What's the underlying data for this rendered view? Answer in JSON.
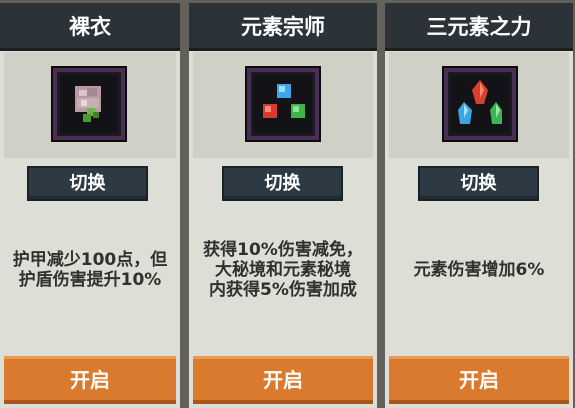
{
  "cards": [
    {
      "title": "裸衣",
      "icon": "naked-robe-icon",
      "switch_label": "切换",
      "description": "护甲减少100点，但\n护盾伤害提升10%",
      "open_label": "开启"
    },
    {
      "title": "元素宗师",
      "icon": "element-master-icon",
      "switch_label": "切换",
      "description": "获得10%伤害减免，\n大秘境和元素秘境\n内获得5%伤害加成",
      "open_label": "开启"
    },
    {
      "title": "三元素之力",
      "icon": "triple-element-icon",
      "switch_label": "切换",
      "description": "元素伤害增加6%",
      "open_label": "开启"
    }
  ],
  "colors": {
    "title_bar": "#2b3338",
    "card_bg": "#dddfd7",
    "switch_button": "#2e3a43",
    "open_button": "#d97a2f",
    "icon_frame_border": "#4a2f55"
  }
}
